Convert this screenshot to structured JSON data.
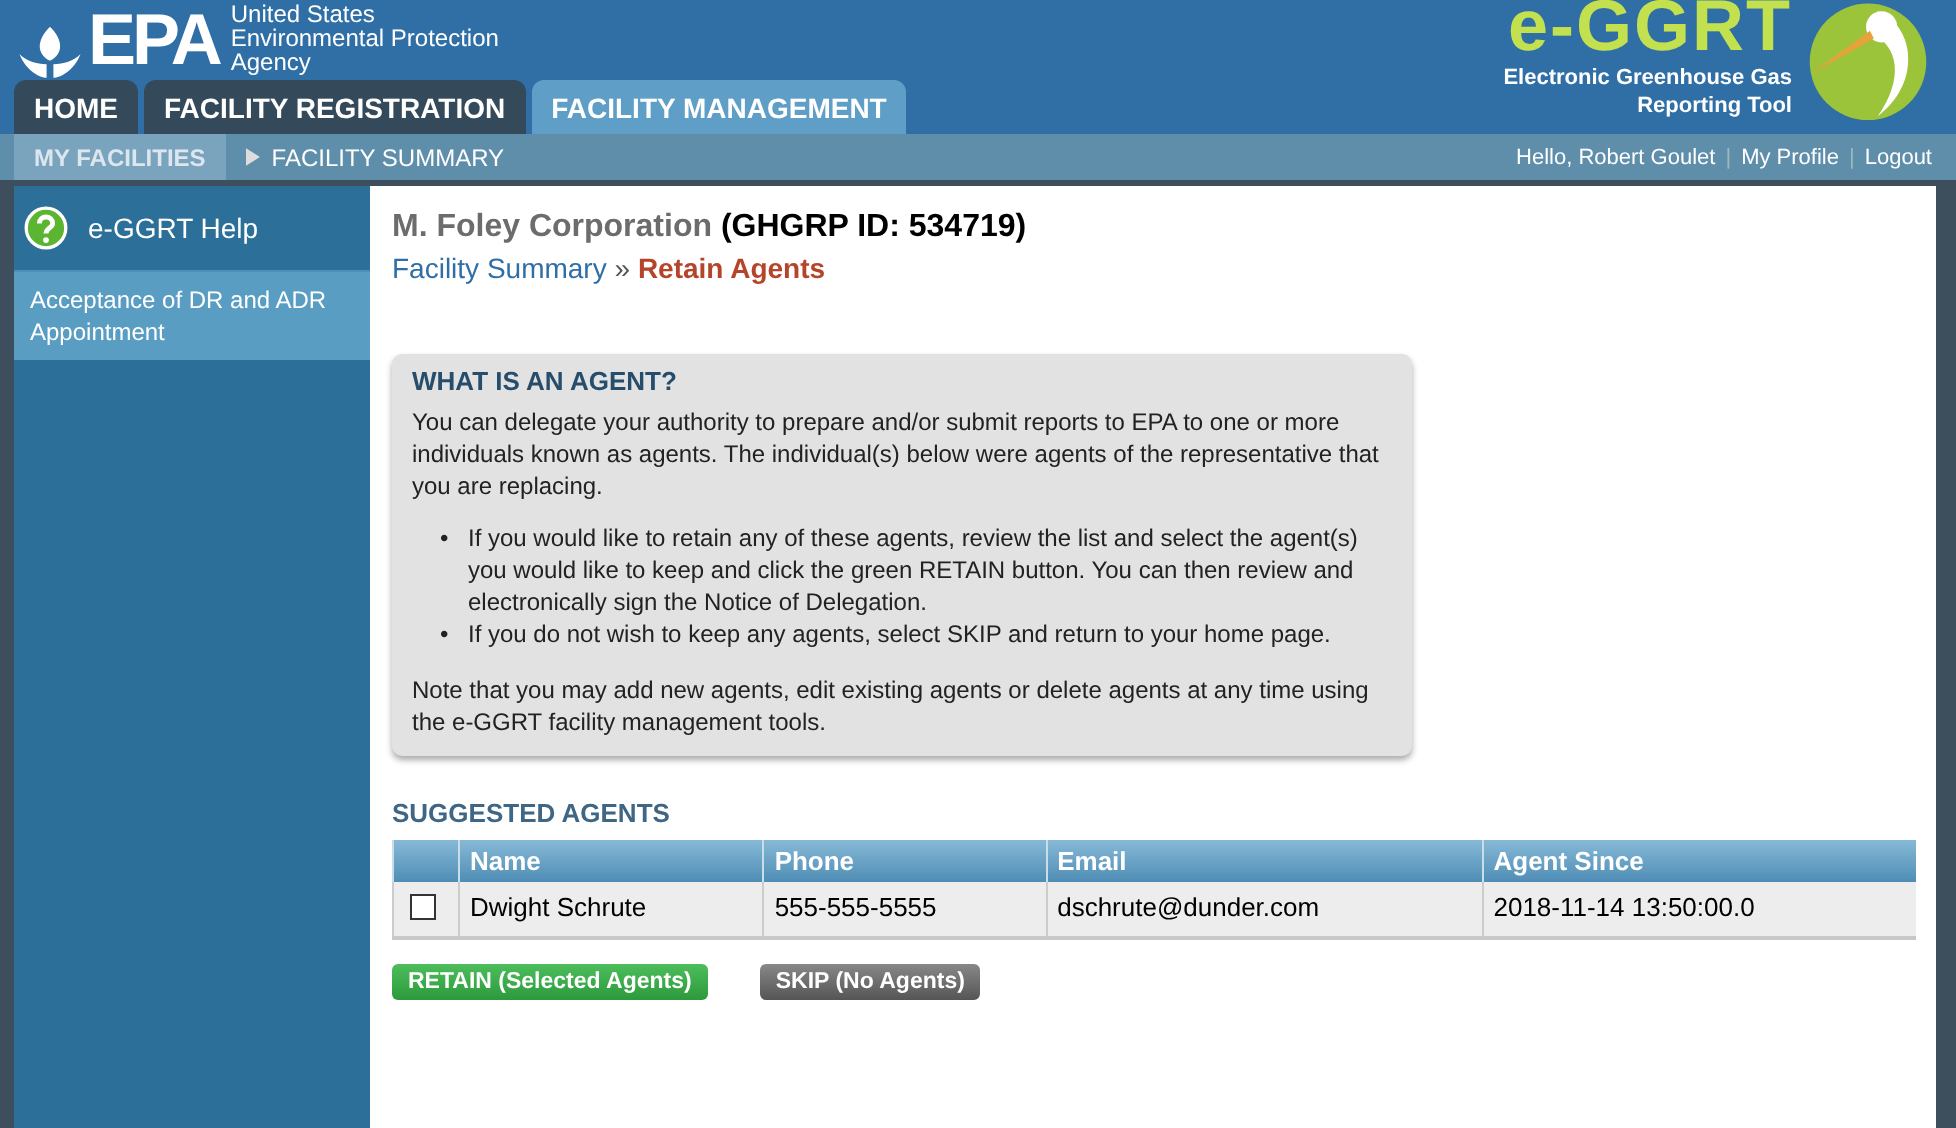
{
  "header": {
    "agency_lines": [
      "United States",
      "Environmental Protection",
      "Agency"
    ],
    "logo_text": "EPA",
    "app_logo": "e-GGRT",
    "app_subtitle_lines": [
      "Electronic Greenhouse Gas",
      "Reporting Tool"
    ]
  },
  "tabs": [
    {
      "label": "HOME",
      "selected": false
    },
    {
      "label": "FACILITY REGISTRATION",
      "selected": false
    },
    {
      "label": "FACILITY MANAGEMENT",
      "selected": true
    }
  ],
  "subnav": [
    {
      "label": "MY FACILITIES",
      "selected": true
    },
    {
      "label": "FACILITY SUMMARY",
      "selected": false
    }
  ],
  "user_bar": {
    "greeting": "Hello, Robert Goulet",
    "separator": "|",
    "links": [
      "My Profile",
      "Logout"
    ]
  },
  "sidebar": {
    "help": "e-GGRT Help",
    "items": [
      {
        "label": "Acceptance of DR and ADR Appointment",
        "selected": true
      }
    ]
  },
  "page": {
    "facility": "M. Foley Corporation",
    "facility_id": "(GHGRP ID: 534719)",
    "breadcrumb": {
      "link": "Facility Summary",
      "separator": "»",
      "current": "Retain Agents"
    }
  },
  "info_box": {
    "title": "WHAT IS AN AGENT?",
    "intro": "You can delegate your authority to prepare and/or submit reports to EPA to one or more individuals known as agents. The individual(s) below were agents of the representative that you are replacing.",
    "bullet_marker": "•",
    "bullets": [
      "If you would like to retain any of these agents, review the list and select the agent(s) you would like to keep and click the green RETAIN button. You can then review and electronically sign the Notice of Delegation.",
      "If you do not wish to keep any agents, select SKIP and return to your home page."
    ],
    "note": "Note that you may add new agents, edit existing agents or delete agents at any time using the e-GGRT facility management tools."
  },
  "agents": {
    "title": "SUGGESTED AGENTS",
    "columns": [
      "Name",
      "Phone",
      "Email",
      "Agent Since"
    ],
    "rows": [
      {
        "checked": false,
        "cells": [
          "Dwight Schrute",
          "555-555-5555",
          "dschrute@dunder.com",
          "2018-11-14 13:50:00.0"
        ]
      }
    ]
  },
  "buttons": [
    {
      "label": "RETAIN (Selected Agents)",
      "kind": "primary"
    },
    {
      "label": "SKIP (No Agents)",
      "kind": "secondary"
    }
  ]
}
